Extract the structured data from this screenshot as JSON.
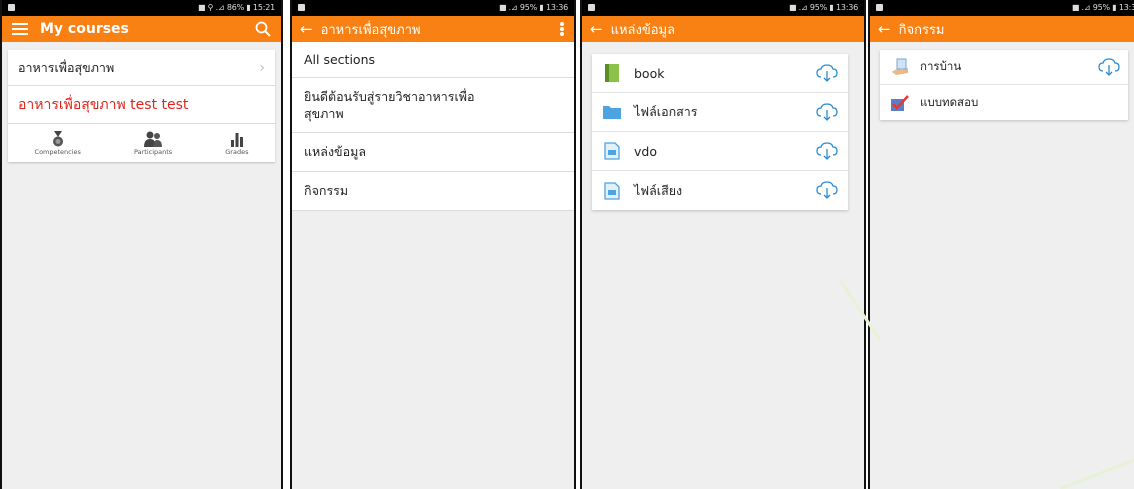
{
  "status_bars": [
    {
      "text": "■ ⚲ .⊿ 86% ▮ 15:21"
    },
    {
      "text": "■ .⊿ 95% ▮ 13:36"
    },
    {
      "text": "■ .⊿ 95% ▮ 13:36"
    },
    {
      "text": "■ .⊿ 95% ▮ 13:3"
    }
  ],
  "screen1": {
    "title": "My courses",
    "courses": [
      {
        "name": "อาหารเพื่อสุขภาพ"
      },
      {
        "name": "อาหารเพื่อสุขภาพ test test"
      }
    ],
    "tools": [
      {
        "label": "Competencies",
        "icon": "medal-icon"
      },
      {
        "label": "Participants",
        "icon": "people-icon"
      },
      {
        "label": "Grades",
        "icon": "bar-chart-icon"
      }
    ]
  },
  "screen2": {
    "title": "อาหารเพื่อสุขภาพ",
    "sections": [
      {
        "label": "All sections"
      },
      {
        "label": "ยินดีต้อนรับสู่รายวิชาอาหารเพื่อ สุขภาพ"
      },
      {
        "label": "แหล่งข้อมูล"
      },
      {
        "label": "กิจกรรม"
      }
    ]
  },
  "screen3": {
    "title": "แหล่งข้อมูล",
    "resources": [
      {
        "label": "book",
        "icon": "book-icon"
      },
      {
        "label": "ไฟล์เอกสาร",
        "icon": "folder-icon"
      },
      {
        "label": "vdo",
        "icon": "page-icon"
      },
      {
        "label": "ไฟล์เสียง",
        "icon": "page-icon"
      }
    ]
  },
  "screen4": {
    "title": "กิจกรรม",
    "activities": [
      {
        "label": "การบ้าน",
        "icon": "assignment-icon"
      },
      {
        "label": "แบบทดสอบ",
        "icon": "quiz-icon"
      }
    ]
  },
  "colors": {
    "accent": "#f98012",
    "highlight_text": "#e2231a",
    "icon_blue": "#2a8bd4"
  }
}
